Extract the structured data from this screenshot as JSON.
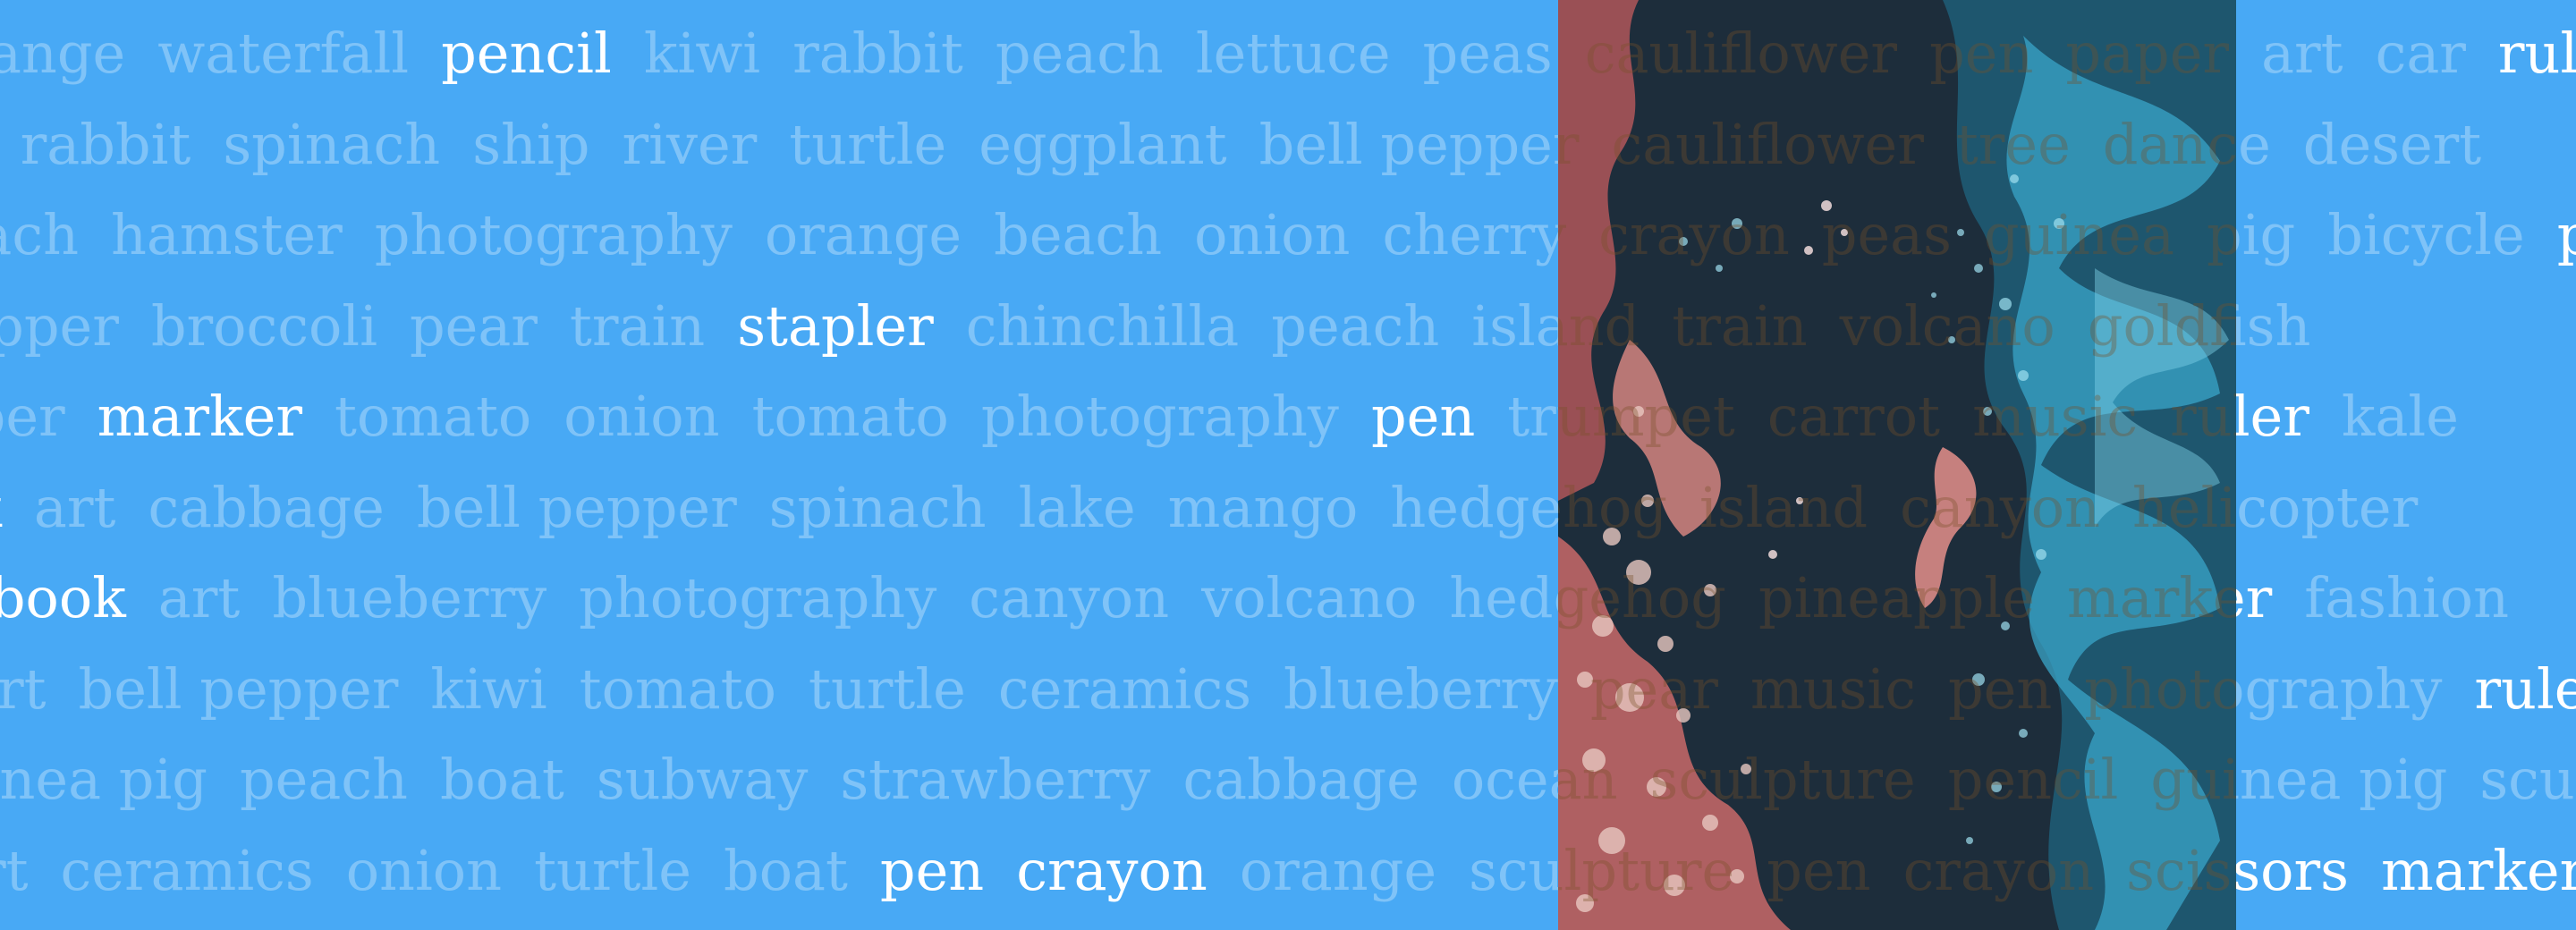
{
  "colors": {
    "background": "#48a9f5",
    "word_faint": "rgba(255,255,255,0.30)",
    "word_highlight": "#ffffff",
    "art_dark": "#1d2d3b",
    "art_teal": "#2e8fb0",
    "art_pink": "#c96a6a"
  },
  "rows": [
    {
      "offset": -80,
      "words": [
        {
          "t": "orange",
          "h": false
        },
        {
          "t": "waterfall",
          "h": false
        },
        {
          "t": "pencil",
          "h": true
        },
        {
          "t": "kiwi",
          "h": false
        },
        {
          "t": "rabbit",
          "h": false
        },
        {
          "t": "peach",
          "h": false
        },
        {
          "t": "lettuce",
          "h": false
        },
        {
          "t": "peas",
          "h": false
        },
        {
          "t": "cauliflower",
          "h": false
        },
        {
          "t": "pen",
          "h": false
        },
        {
          "t": "paper",
          "h": false
        },
        {
          "t": "art",
          "h": false
        },
        {
          "t": "car",
          "h": false
        },
        {
          "t": "ruler",
          "h": true
        }
      ]
    },
    {
      "offset": -130,
      "words": [
        {
          "t": "pan",
          "h": false
        },
        {
          "t": "rabbit",
          "h": false
        },
        {
          "t": "spinach",
          "h": false
        },
        {
          "t": "ship",
          "h": false
        },
        {
          "t": "river",
          "h": false
        },
        {
          "t": "turtle",
          "h": false
        },
        {
          "t": "eggplant",
          "h": false
        },
        {
          "t": "bell pepper",
          "h": false
        },
        {
          "t": "cauliflower",
          "h": false
        },
        {
          "t": "tree",
          "h": false
        },
        {
          "t": "dance",
          "h": false
        },
        {
          "t": "desert",
          "h": false
        }
      ]
    },
    {
      "offset": -100,
      "words": [
        {
          "t": "beach",
          "h": false
        },
        {
          "t": "hamster",
          "h": false
        },
        {
          "t": "photography",
          "h": false
        },
        {
          "t": "orange",
          "h": false
        },
        {
          "t": "beach",
          "h": false
        },
        {
          "t": "onion",
          "h": false
        },
        {
          "t": "cherry",
          "h": false
        },
        {
          "t": "crayon",
          "h": false
        },
        {
          "t": "peas",
          "h": false
        },
        {
          "t": "guinea",
          "h": false
        },
        {
          "t": "pig",
          "h": false
        },
        {
          "t": "bicycle",
          "h": false
        },
        {
          "t": "pen",
          "h": true
        }
      ]
    },
    {
      "offset": -225,
      "words": [
        {
          "t": "bell pepper",
          "h": false
        },
        {
          "t": "broccoli",
          "h": false
        },
        {
          "t": "pear",
          "h": false
        },
        {
          "t": "train",
          "h": false
        },
        {
          "t": "stapler",
          "h": true
        },
        {
          "t": "chinchilla",
          "h": false
        },
        {
          "t": "peach",
          "h": false
        },
        {
          "t": "island",
          "h": false
        },
        {
          "t": "train",
          "h": false
        },
        {
          "t": "volcano",
          "h": false
        },
        {
          "t": "goldfish",
          "h": false
        }
      ]
    },
    {
      "offset": -110,
      "words": [
        {
          "t": "paper",
          "h": false
        },
        {
          "t": "marker",
          "h": true
        },
        {
          "t": "tomato",
          "h": false
        },
        {
          "t": "onion",
          "h": false
        },
        {
          "t": "tomato",
          "h": false
        },
        {
          "t": "photography",
          "h": false
        },
        {
          "t": "pen",
          "h": true
        },
        {
          "t": "trumpet",
          "h": false
        },
        {
          "t": "carrot",
          "h": false
        },
        {
          "t": "music",
          "h": false
        },
        {
          "t": "ruler",
          "h": true
        },
        {
          "t": "kale",
          "h": false
        }
      ]
    },
    {
      "offset": -150,
      "words": [
        {
          "t": "book",
          "h": true
        },
        {
          "t": "art",
          "h": false
        },
        {
          "t": "cabbage",
          "h": false
        },
        {
          "t": "bell pepper",
          "h": false
        },
        {
          "t": "spinach",
          "h": false
        },
        {
          "t": "lake",
          "h": false
        },
        {
          "t": "mango",
          "h": false
        },
        {
          "t": "hedgehog",
          "h": false
        },
        {
          "t": "island",
          "h": false
        },
        {
          "t": "canyon",
          "h": false
        },
        {
          "t": "helicopter",
          "h": false
        }
      ]
    },
    {
      "offset": -150,
      "words": [
        {
          "t": "notebook",
          "h": true
        },
        {
          "t": "art",
          "h": false
        },
        {
          "t": "blueberry",
          "h": false
        },
        {
          "t": "photography",
          "h": false
        },
        {
          "t": "canyon",
          "h": false
        },
        {
          "t": "volcano",
          "h": false
        },
        {
          "t": "hedgehog",
          "h": false
        },
        {
          "t": "pineapple",
          "h": false
        },
        {
          "t": "marker",
          "h": true
        },
        {
          "t": "fashion",
          "h": false
        }
      ]
    },
    {
      "offset": -40,
      "words": [
        {
          "t": "art",
          "h": false
        },
        {
          "t": "bell pepper",
          "h": false
        },
        {
          "t": "kiwi",
          "h": false
        },
        {
          "t": "tomato",
          "h": false
        },
        {
          "t": "turtle",
          "h": false
        },
        {
          "t": "ceramics",
          "h": false
        },
        {
          "t": "blueberry",
          "h": false
        },
        {
          "t": "pear",
          "h": false
        },
        {
          "t": "music",
          "h": false
        },
        {
          "t": "pen",
          "h": false
        },
        {
          "t": "photography",
          "h": false
        },
        {
          "t": "ruler",
          "h": true
        }
      ]
    },
    {
      "offset": -100,
      "words": [
        {
          "t": "guinea pig",
          "h": false
        },
        {
          "t": "peach",
          "h": false
        },
        {
          "t": "boat",
          "h": false
        },
        {
          "t": "subway",
          "h": false
        },
        {
          "t": "strawberry",
          "h": false
        },
        {
          "t": "cabbage",
          "h": false
        },
        {
          "t": "ocean",
          "h": false
        },
        {
          "t": "sculpture",
          "h": false
        },
        {
          "t": "pencil",
          "h": false
        },
        {
          "t": "guinea pig",
          "h": false
        },
        {
          "t": "sculpture",
          "h": false
        }
      ]
    },
    {
      "offset": -60,
      "words": [
        {
          "t": "art",
          "h": false
        },
        {
          "t": "ceramics",
          "h": false
        },
        {
          "t": "onion",
          "h": false
        },
        {
          "t": "turtle",
          "h": false
        },
        {
          "t": "boat",
          "h": false
        },
        {
          "t": "pen",
          "h": true
        },
        {
          "t": "crayon",
          "h": true
        },
        {
          "t": "orange",
          "h": false
        },
        {
          "t": "sculpture",
          "h": false
        },
        {
          "t": "pen",
          "h": false
        },
        {
          "t": "crayon",
          "h": false
        },
        {
          "t": "scissors",
          "h": true
        },
        {
          "t": "marker",
          "h": true
        }
      ]
    }
  ],
  "artwork": {
    "description_icon": "fluid-art-image"
  }
}
